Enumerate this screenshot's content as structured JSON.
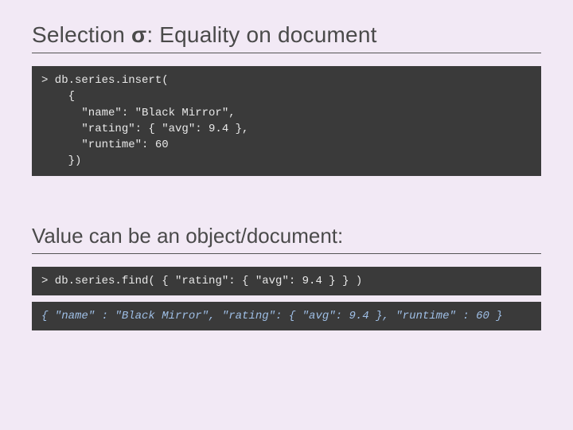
{
  "slide": {
    "title_pre": "Selection ",
    "title_sigma": "σ",
    "title_post": ": Equality on document",
    "code1_prompt": ">",
    "code1_body": " db.series.insert(\n    {\n      \"name\": \"Black Mirror\",\n      \"rating\": { \"avg\": 9.4 },\n      \"runtime\": 60\n    })",
    "subtitle": "Value can be an object/document:",
    "code2_prompt": ">",
    "code2_body": " db.series.find( { \"rating\": { \"avg\": 9.4 } } )",
    "code3_result": "{ \"name\" : \"Black Mirror\", \"rating\": { \"avg\": 9.4 }, \"runtime\" : 60 }"
  }
}
